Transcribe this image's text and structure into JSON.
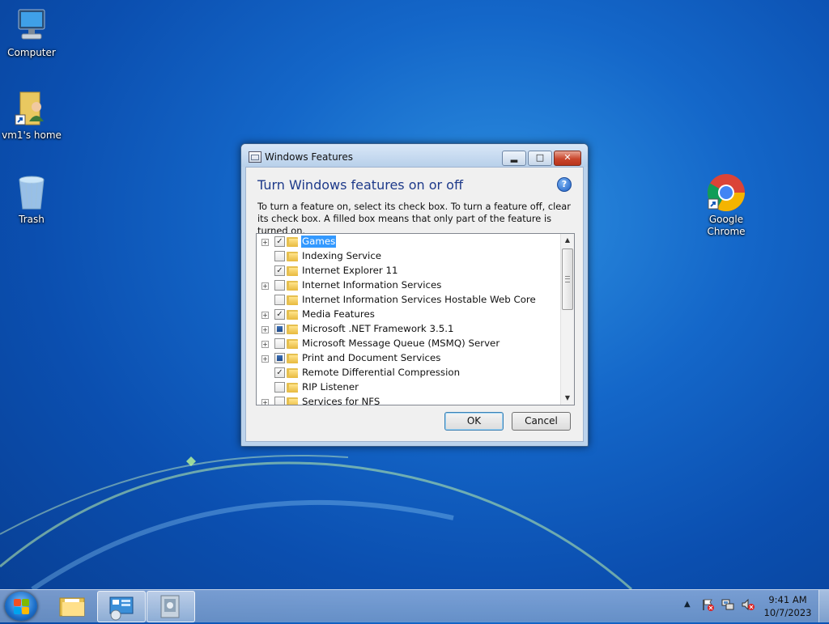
{
  "desktop": {
    "icons": [
      {
        "label": "Computer"
      },
      {
        "label": "vm1's home"
      },
      {
        "label": "Trash"
      },
      {
        "label": "Google Chrome"
      }
    ]
  },
  "window": {
    "title": "Windows Features",
    "heading": "Turn Windows features on or off",
    "description": "To turn a feature on, select its check box. To turn a feature off, clear its check box. A filled box means that only part of the feature is turned on.",
    "help_glyph": "?",
    "features": [
      {
        "name": "Games",
        "expandable": true,
        "state": "checked",
        "selected": true
      },
      {
        "name": "Indexing Service",
        "expandable": false,
        "state": "unchecked"
      },
      {
        "name": "Internet Explorer 11",
        "expandable": false,
        "state": "checked"
      },
      {
        "name": "Internet Information Services",
        "expandable": true,
        "state": "unchecked"
      },
      {
        "name": "Internet Information Services Hostable Web Core",
        "expandable": false,
        "state": "unchecked"
      },
      {
        "name": "Media Features",
        "expandable": true,
        "state": "checked"
      },
      {
        "name": "Microsoft .NET Framework 3.5.1",
        "expandable": true,
        "state": "partial"
      },
      {
        "name": "Microsoft Message Queue (MSMQ) Server",
        "expandable": true,
        "state": "unchecked"
      },
      {
        "name": "Print and Document Services",
        "expandable": true,
        "state": "partial"
      },
      {
        "name": "Remote Differential Compression",
        "expandable": false,
        "state": "checked"
      },
      {
        "name": "RIP Listener",
        "expandable": false,
        "state": "unchecked"
      },
      {
        "name": "Services for NFS",
        "expandable": true,
        "state": "unchecked"
      }
    ],
    "ok_label": "OK",
    "cancel_label": "Cancel"
  },
  "taskbar": {
    "clock_time": "9:41 AM",
    "clock_date": "10/7/2023",
    "tray_icons": [
      "flag-icon",
      "network-icon",
      "volume-muted-icon"
    ]
  },
  "colors": {
    "selection": "#3399ff",
    "heading": "#1e3a8a",
    "close_button": "#c9462c"
  }
}
